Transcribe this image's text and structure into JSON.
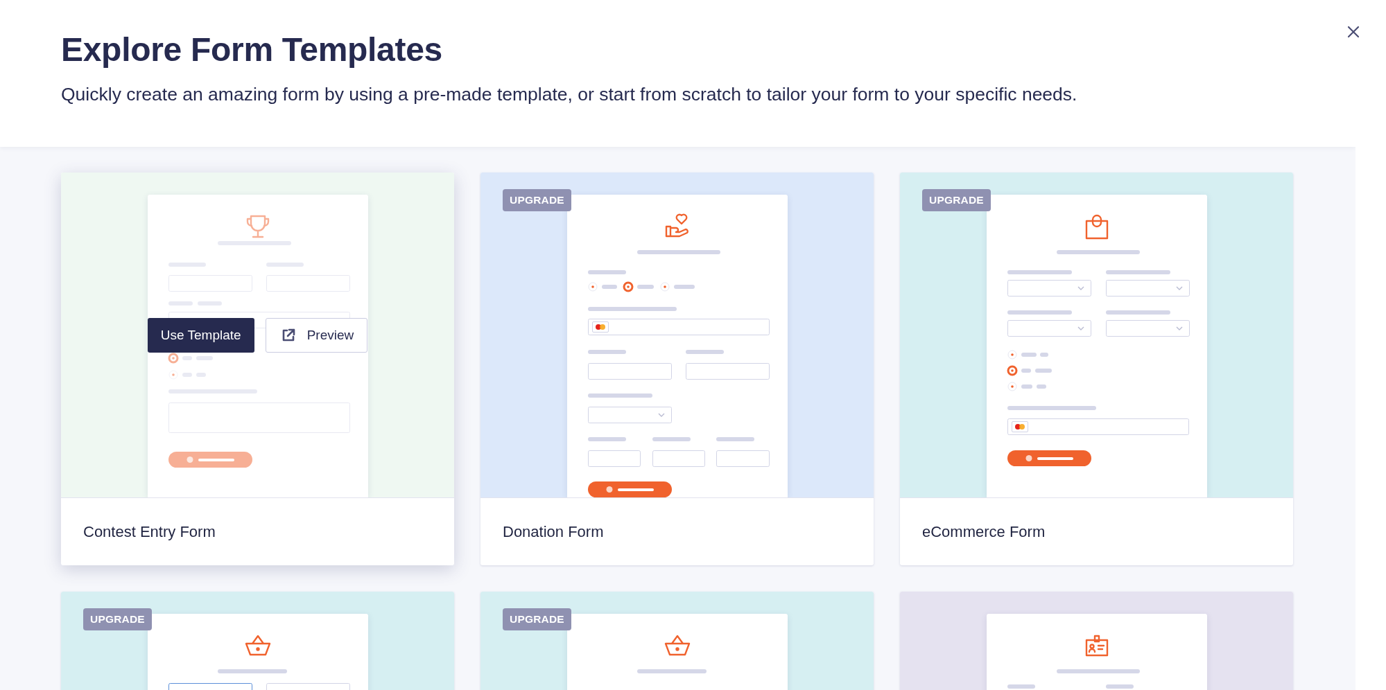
{
  "dialog": {
    "title": "Explore Form Templates",
    "subtitle": "Quickly create an amazing form by using a pre-made template, or start from scratch to tailor your form to your specific needs."
  },
  "templates": [
    {
      "name": "Contest Entry Form",
      "kind": "contest",
      "color": "#eff8f2",
      "upgrade": false,
      "hovered": true,
      "actions": [
        {
          "kind": "primary",
          "label": "Use Template"
        },
        {
          "kind": "preview",
          "label": "Preview"
        }
      ]
    },
    {
      "name": "Donation Form",
      "kind": "donation",
      "color": "#dce8fa",
      "upgrade": true,
      "upgrade_label": "UPGRADE",
      "hovered": false
    },
    {
      "name": "eCommerce Form",
      "kind": "shop",
      "color": "#d6eff2",
      "upgrade": true,
      "upgrade_label": "UPGRADE",
      "hovered": false
    },
    {
      "kind": "basket-fields",
      "color": "#d6eff2",
      "upgrade": true,
      "upgrade_label": "UPGRADE",
      "hovered": false
    },
    {
      "kind": "basket",
      "color": "#d6eff2",
      "upgrade": true,
      "upgrade_label": "UPGRADE",
      "hovered": false
    },
    {
      "kind": "badge",
      "color": "#e5e2f0",
      "upgrade": false,
      "hovered": false
    }
  ]
}
